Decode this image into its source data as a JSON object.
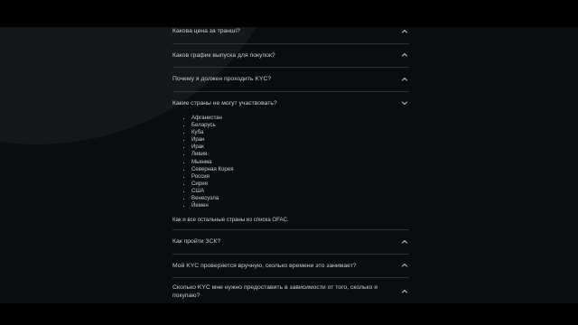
{
  "faq": {
    "items": [
      {
        "question": "Какова цена за траншi?"
      },
      {
        "question": "Каков график выпуска для покупок?"
      },
      {
        "question": "Почему я должен проходить KYC?"
      },
      {
        "question": "Какие страны не могут участвовать?",
        "expanded": true,
        "countries": [
          "Афганистан",
          "Беларусь",
          "Куба",
          "Иран",
          "Ирак",
          "Ливия",
          "Мьянма",
          "Северная Корея",
          "Россия",
          "Сирия",
          "США",
          "Венесуэла",
          "Йемен"
        ],
        "note": "Как и все остальные страны из списка OFAC."
      },
      {
        "question": "Как пройти ЗСК?"
      },
      {
        "question": "Мой KYC проверяется вручную, сколько времени это занимает?"
      },
      {
        "question": "Сколько KYC мне нужно предоставить в зависимости от того, сколько я покупаю?"
      }
    ]
  },
  "icons": {
    "collapsed": "chevron-up-icon",
    "expanded": "chevron-down-icon"
  },
  "colors": {
    "background": "#0b0c0f",
    "letterbox": "#000000",
    "text": "#c9cbd0",
    "divider": "#2e3034"
  }
}
